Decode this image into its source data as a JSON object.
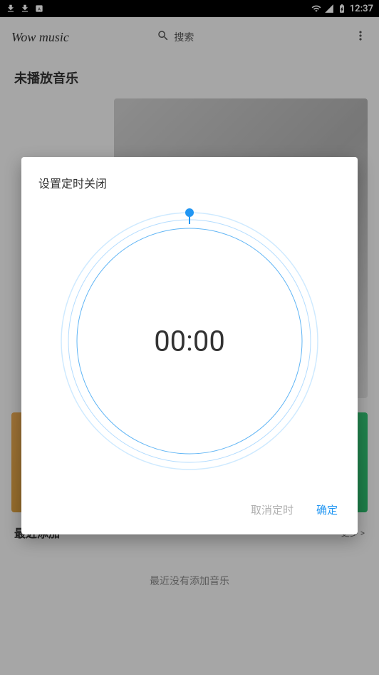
{
  "status_bar": {
    "time": "12:37"
  },
  "app_bar": {
    "title": "Wow music",
    "search_label": "搜索"
  },
  "main": {
    "page_title": "未播放音乐",
    "recent_section_title": "最近添加",
    "recent_more": "更多 >",
    "recent_empty": "最近没有添加音乐"
  },
  "dialog": {
    "title": "设置定时关闭",
    "timer_value": "00:00",
    "cancel_label": "取消定时",
    "confirm_label": "确定"
  }
}
